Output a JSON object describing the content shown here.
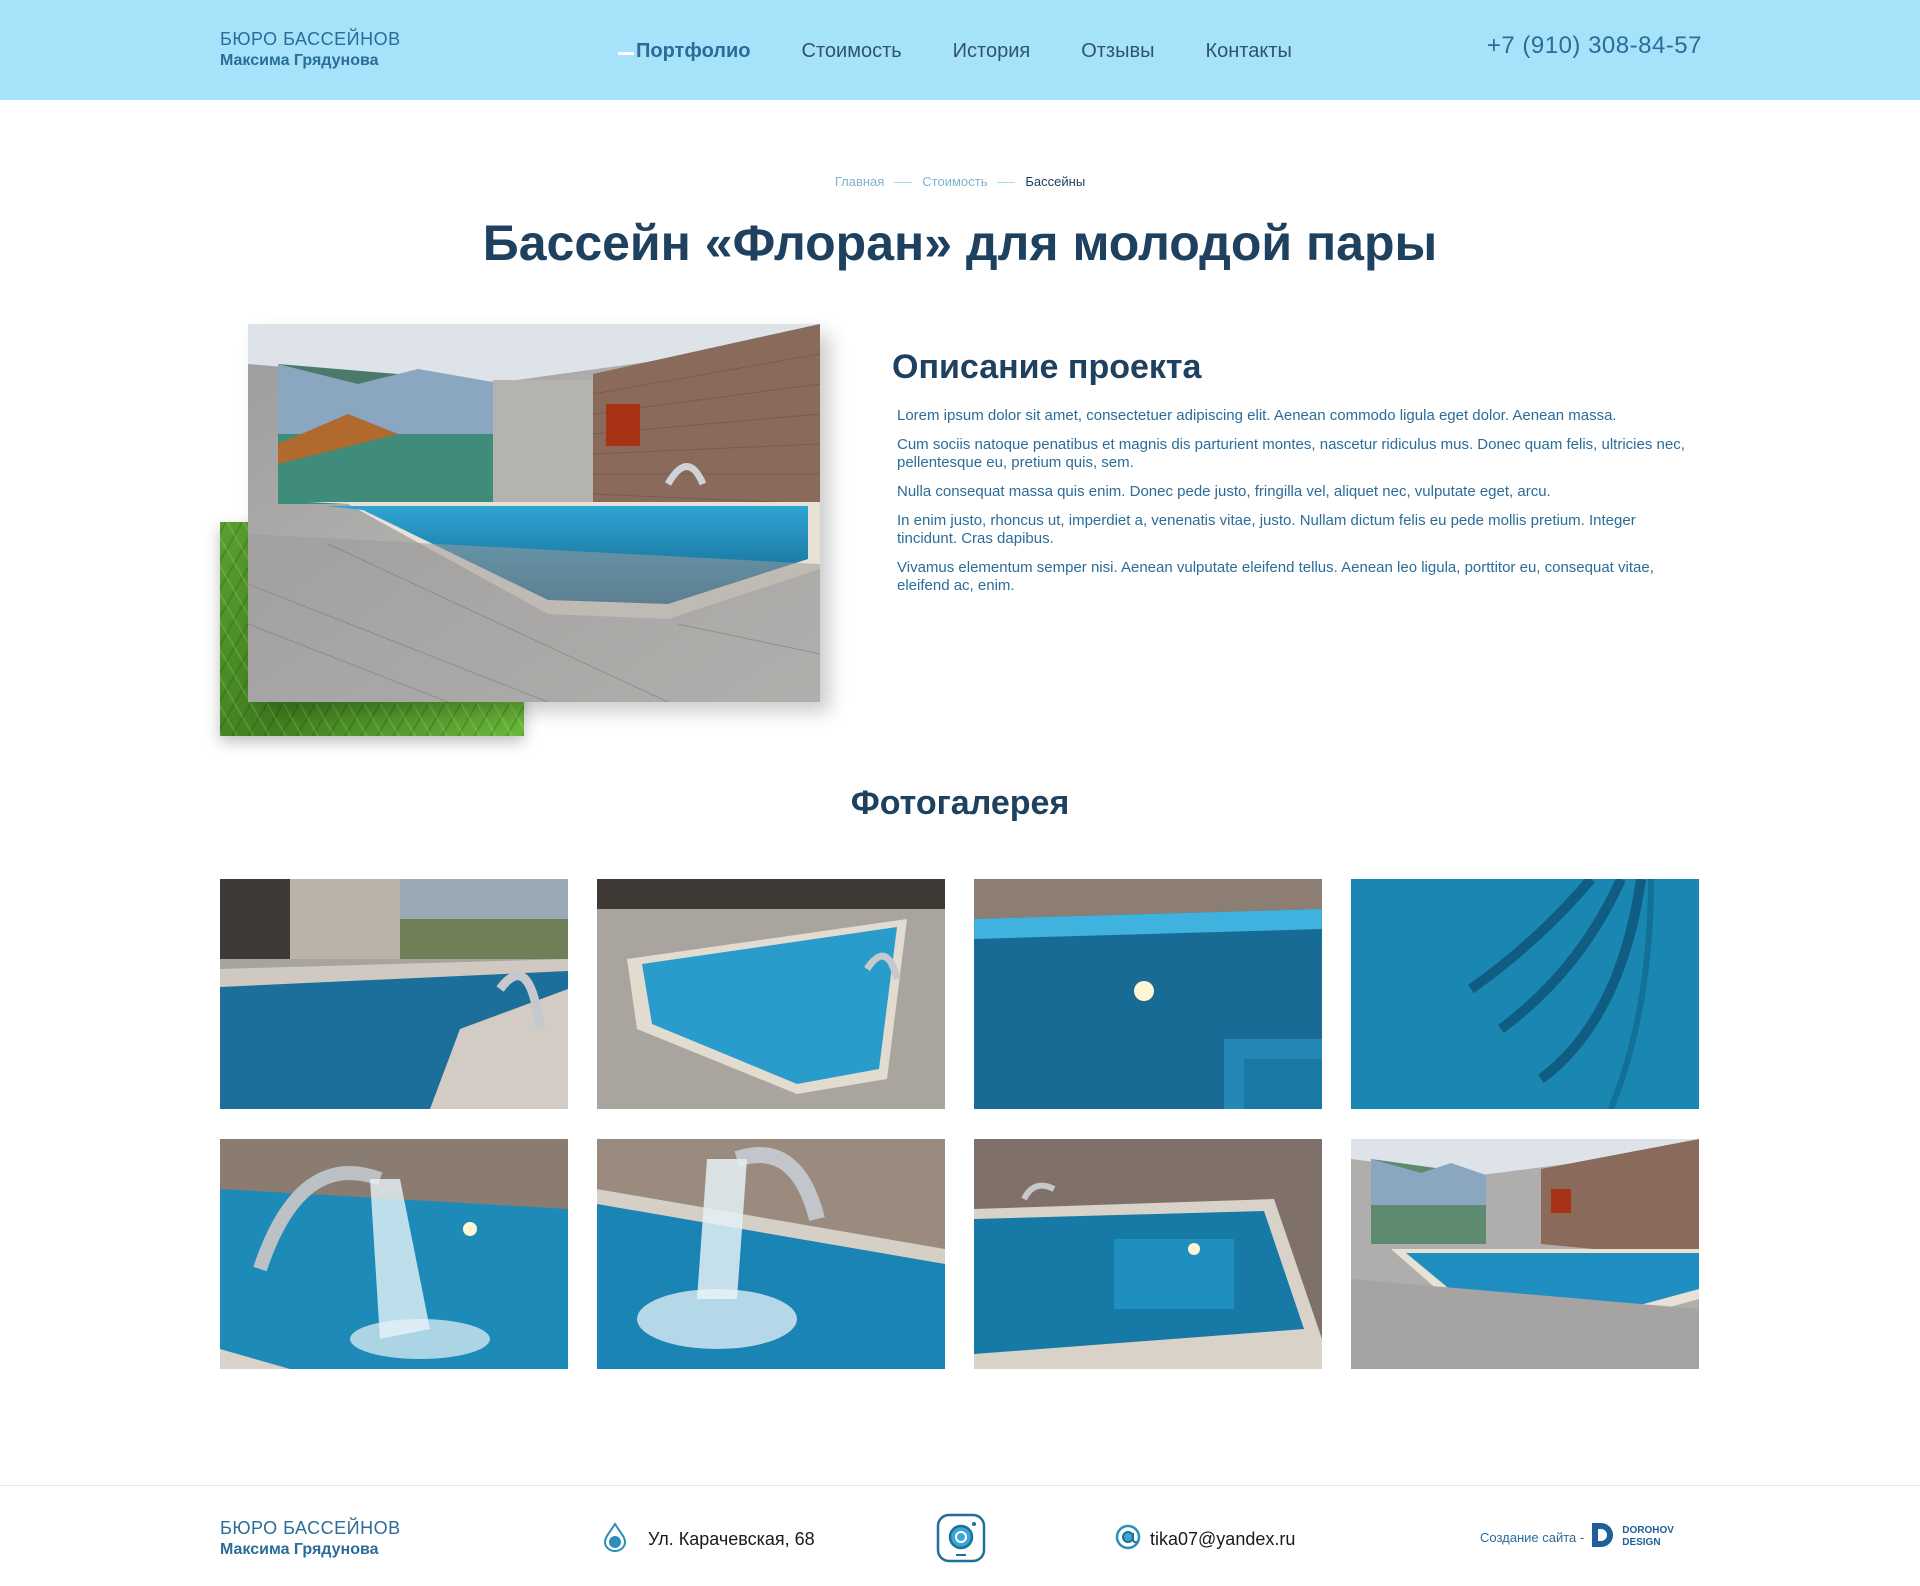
{
  "header": {
    "logo_line1": "БЮРО БАССЕЙНОВ",
    "logo_line2": "Максима Грядунова",
    "nav": [
      {
        "label": "Портфолио",
        "active": true
      },
      {
        "label": "Стоимость",
        "active": false
      },
      {
        "label": "История",
        "active": false
      },
      {
        "label": "Отзывы",
        "active": false
      },
      {
        "label": "Контакты",
        "active": false
      }
    ],
    "phone": "+7 (910) 308-84-57"
  },
  "breadcrumb": [
    "Главная",
    "Стоимость",
    "Бассейны"
  ],
  "title": "Бассейн «Флоран» для молодой пары",
  "description": {
    "heading": "Описание проекта",
    "paragraphs": [
      "Lorem ipsum dolor sit amet, consectetuer adipiscing elit. Aenean commodo ligula eget dolor. Aenean massa.",
      "Cum sociis natoque penatibus et magnis dis parturient montes, nascetur ridiculus mus. Donec quam felis, ultricies nec, pellentesque eu, pretium quis, sem.",
      "Nulla consequat massa quis enim. Donec pede justo, fringilla vel, aliquet nec, vulputate eget, arcu.",
      "In enim justo, rhoncus ut, imperdiet a, venenatis vitae, justo. Nullam dictum felis eu pede mollis pretium. Integer tincidunt. Cras dapibus.",
      "Vivamus elementum semper nisi. Aenean vulputate eleifend tellus. Aenean leo ligula, porttitor eu, consequat vitae, eleifend ac, enim."
    ]
  },
  "gallery": {
    "heading": "Фотогалерея",
    "photo_count": 8
  },
  "footer": {
    "logo_line1": "БЮРО БАССЕЙНОВ",
    "logo_line2": "Максима Грядунова",
    "address": "Ул. Карачевская, 68",
    "email": "tika07@yandex.ru",
    "credit_label": "Создание сайта -",
    "credit_brand_line1": "DOROHOV",
    "credit_brand_line2": "DESIGN"
  },
  "colors": {
    "header_bg": "#a6e3fb",
    "accent": "#2b6c99",
    "title": "#1f4160",
    "water": "#1f8fc1"
  },
  "icons": {
    "address": "water-drop-icon",
    "social": "instagram-icon",
    "email": "at-sign-icon",
    "credit": "dorohov-design-logo"
  }
}
